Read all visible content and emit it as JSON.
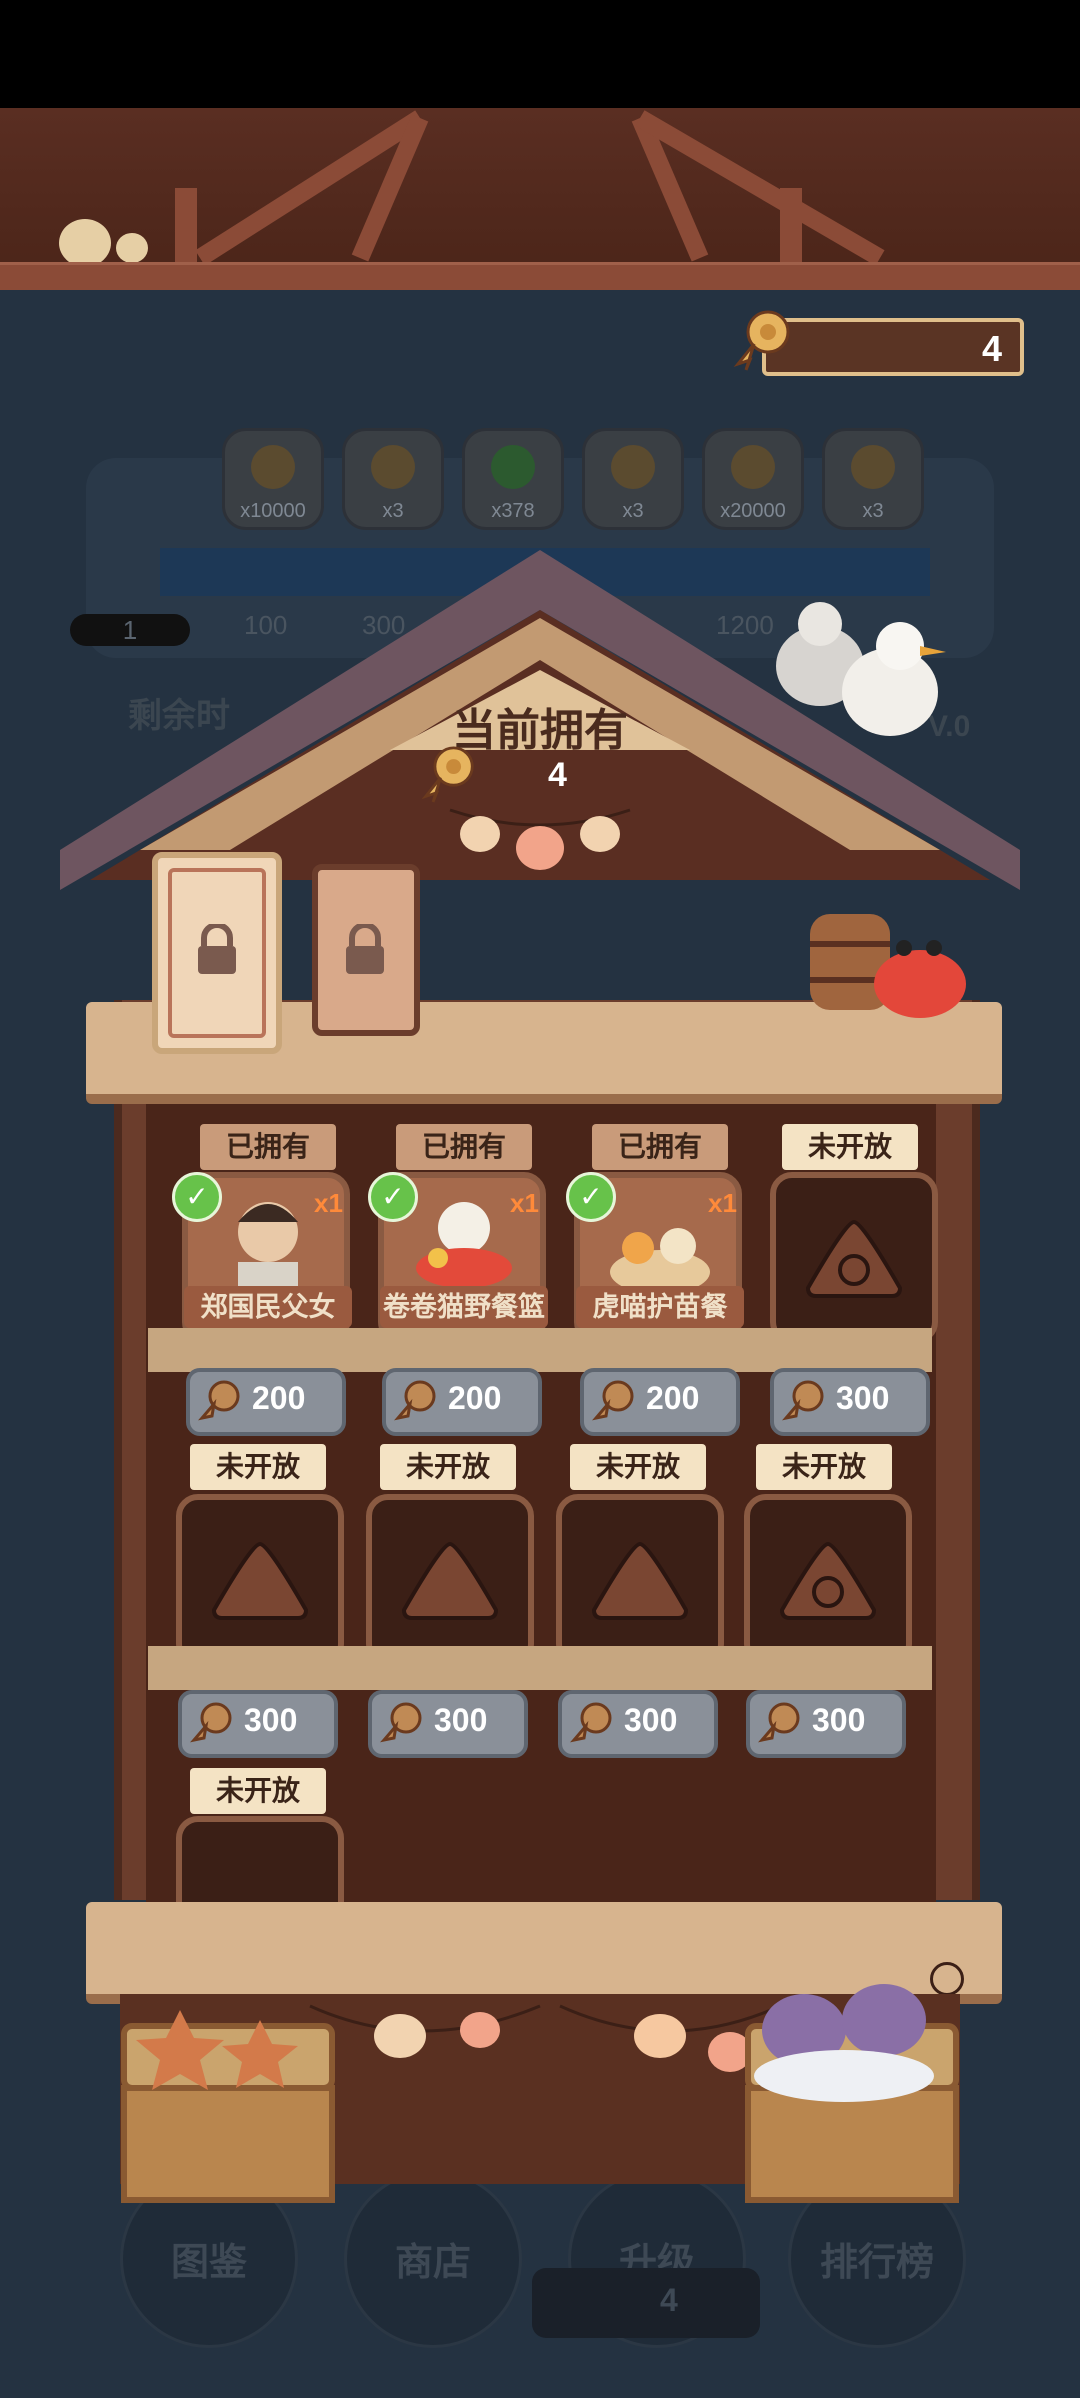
{
  "header": {
    "top_currency": "4"
  },
  "background": {
    "rewards": [
      "x10000",
      "x3",
      "x378",
      "x3",
      "x20000",
      "x3"
    ],
    "milestones": [
      "1",
      "100",
      "300",
      "1200"
    ],
    "remaining_label": "剩余时",
    "level_tag": "V.0"
  },
  "modal": {
    "title": "当前拥有",
    "owned_count": "4",
    "rows": [
      [
        {
          "tag": "已拥有",
          "name": "郑国民父女",
          "qty": "x1",
          "price": "200"
        },
        {
          "tag": "已拥有",
          "name": "卷卷猫野餐篮",
          "qty": "x1",
          "price": "200"
        },
        {
          "tag": "已拥有",
          "name": "虎喵护苗餐",
          "qty": "x1",
          "price": "200"
        },
        {
          "tag": "未开放",
          "price": "300"
        }
      ],
      [
        {
          "tag": "未开放",
          "price": "300"
        },
        {
          "tag": "未开放",
          "price": "300"
        },
        {
          "tag": "未开放",
          "price": "300"
        },
        {
          "tag": "未开放",
          "price": "300"
        }
      ],
      [
        {
          "tag": "未开放"
        }
      ]
    ]
  },
  "nav": {
    "items": [
      "图鉴",
      "商店",
      "升级",
      "排行榜"
    ],
    "counter": "4"
  },
  "colors": {
    "accent": "#e0bf8b",
    "owned_check": "#67c24a",
    "qty": "#ff8a3a"
  }
}
